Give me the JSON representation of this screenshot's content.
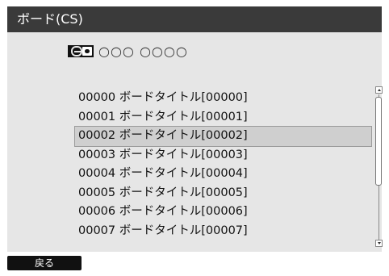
{
  "header": {
    "title": "ボード(CS)"
  },
  "channel": {
    "badge_icon": "cs-broadcast-icon",
    "digits": "○○○ ○○○○"
  },
  "board_list": {
    "items": [
      "00000 ボードタイトル[00000]",
      "00001 ボードタイトル[00001]",
      "00002 ボードタイトル[00002]",
      "00003 ボードタイトル[00003]",
      "00004 ボードタイトル[00004]",
      "00005 ボードタイトル[00005]",
      "00006 ボードタイトル[00006]",
      "00007 ボードタイトル[00007]"
    ],
    "selected_index": 2
  },
  "footer": {
    "back_label": "戻る"
  },
  "colors": {
    "title_bar": "#3a3a3a",
    "panel": "#e6e6e6",
    "selected_row": "#cfcfcf"
  }
}
